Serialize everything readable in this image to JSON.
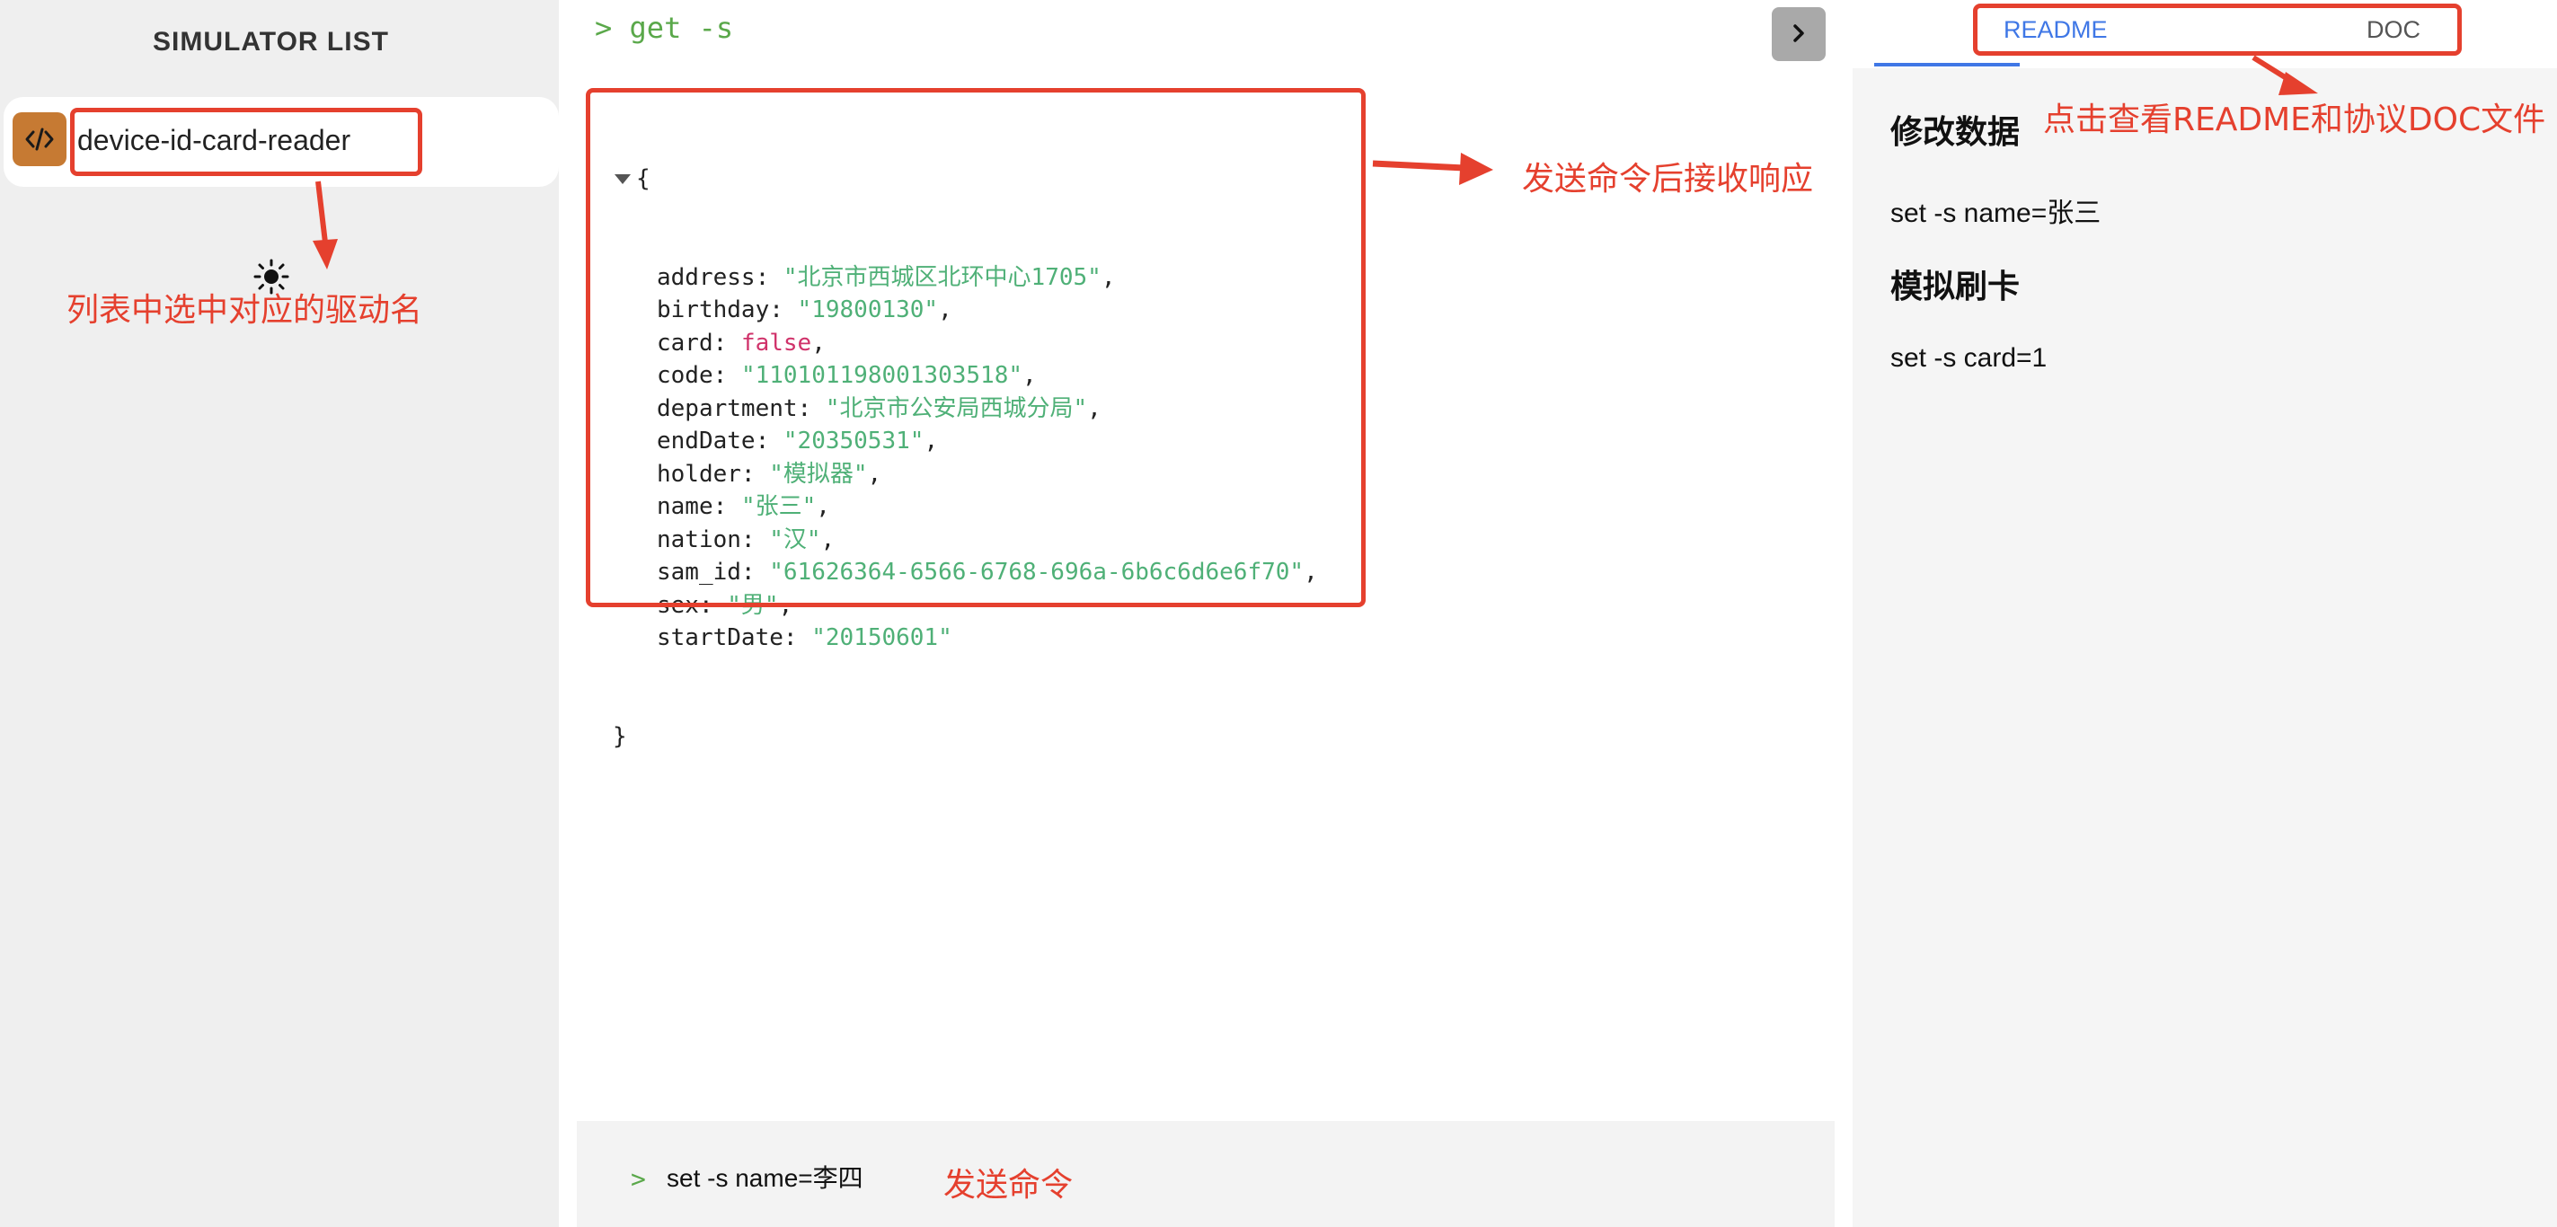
{
  "sidebar": {
    "title": "SIMULATOR LIST",
    "items": [
      {
        "label": "device-id-card-reader",
        "icon": "code-icon",
        "selected": true
      }
    ]
  },
  "console": {
    "echo_prompt": ">",
    "echo_command": "get -s",
    "response": {
      "open_brace": "{",
      "close_brace": "}",
      "fields": [
        {
          "key": "address",
          "value": "\"北京市西城区北环中心1705\"",
          "type": "string"
        },
        {
          "key": "birthday",
          "value": "\"19800130\"",
          "type": "string"
        },
        {
          "key": "card",
          "value": "false",
          "type": "boolean"
        },
        {
          "key": "code",
          "value": "\"110101198001303518\"",
          "type": "string"
        },
        {
          "key": "department",
          "value": "\"北京市公安局西城分局\"",
          "type": "string"
        },
        {
          "key": "endDate",
          "value": "\"20350531\"",
          "type": "string"
        },
        {
          "key": "holder",
          "value": "\"模拟器\"",
          "type": "string"
        },
        {
          "key": "name",
          "value": "\"张三\"",
          "type": "string"
        },
        {
          "key": "nation",
          "value": "\"汉\"",
          "type": "string"
        },
        {
          "key": "sam_id",
          "value": "\"61626364-6566-6768-696a-6b6c6d6e6f70\"",
          "type": "string"
        },
        {
          "key": "sex",
          "value": "\"男\"",
          "type": "string"
        },
        {
          "key": "startDate",
          "value": "\"20150601\"",
          "type": "string"
        }
      ]
    },
    "input_prompt": ">",
    "input_value": "set -s name=李四",
    "run_icon": "chevron-right-icon"
  },
  "docs": {
    "tabs": [
      {
        "label": "README",
        "active": true
      },
      {
        "label": "DOC",
        "active": false
      }
    ],
    "content": [
      {
        "kind": "heading",
        "text": "修改数据"
      },
      {
        "kind": "paragraph",
        "text": "set -s name=张三"
      },
      {
        "kind": "heading",
        "text": "模拟刷卡"
      },
      {
        "kind": "paragraph",
        "text": "set -s card=1"
      }
    ]
  },
  "annotations": {
    "selected_driver": "列表中选中对应的驱动名",
    "response": "发送命令后接收响应",
    "tabs": "点击查看README和协议DOC文件",
    "send": "发送命令"
  },
  "colors": {
    "accent": "#3f77e6",
    "annotation": "#e5402e",
    "prompt_green": "#5aa84a",
    "json_string": "#4fb077",
    "json_boolean": "#d0326a",
    "icon_orange": "#c67a33"
  }
}
